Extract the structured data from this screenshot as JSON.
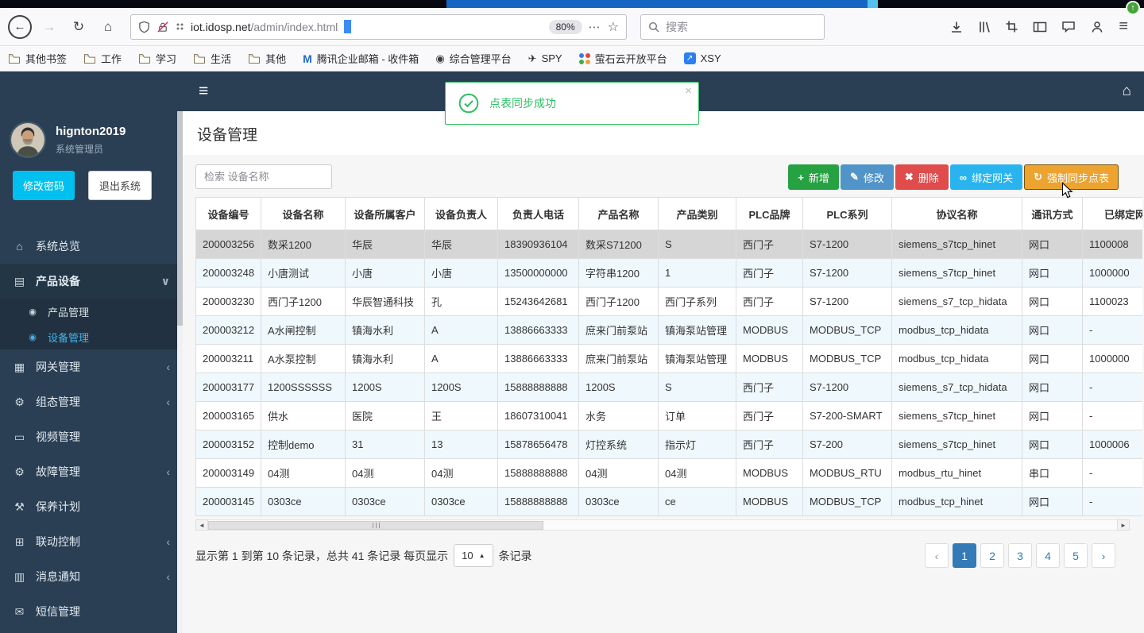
{
  "browser": {
    "nav": {
      "back": "←",
      "forward": "→",
      "reload": "↻",
      "home": "⌂"
    },
    "urlbar": {
      "domain": "iot.idosp.net",
      "path": "/admin/index.html",
      "zoom": "80%",
      "overflow": "⋯",
      "star": "☆"
    },
    "search": {
      "placeholder": "搜索"
    },
    "menu_glyph": "≡",
    "update_badge": "↑",
    "bookmarks": [
      {
        "label": "其他书签",
        "type": "folder"
      },
      {
        "label": "工作",
        "type": "folder"
      },
      {
        "label": "学习",
        "type": "folder"
      },
      {
        "label": "生活",
        "type": "folder"
      },
      {
        "label": "其他",
        "type": "folder"
      },
      {
        "label": "腾讯企业邮箱 - 收件箱",
        "type": "site",
        "icon": "mail-favicon",
        "fav": {
          "kind": "letter",
          "text": "M",
          "color": "#2468c8"
        }
      },
      {
        "label": "综合管理平台",
        "type": "site",
        "icon": "globe-favicon",
        "fav": {
          "kind": "glyph",
          "text": "◉",
          "color": "#3c3c43"
        }
      },
      {
        "label": "SPY",
        "type": "site",
        "icon": "plane-favicon",
        "fav": {
          "kind": "glyph",
          "text": "✈",
          "color": "#2f2f35"
        }
      },
      {
        "label": "萤石云开放平台",
        "type": "site",
        "icon": "dots-favicon",
        "fav": {
          "kind": "dots"
        }
      },
      {
        "label": "XSY",
        "type": "site",
        "icon": "arrow-square-favicon",
        "fav": {
          "kind": "square",
          "text": "↗",
          "color": "#2d7ff0"
        }
      }
    ]
  },
  "app": {
    "header": {
      "hamburger": "≡",
      "home": "⌂"
    },
    "toast": {
      "message": "点表同步成功",
      "close": "×"
    },
    "sidebar": {
      "username": "hignton2019",
      "role": "系统管理员",
      "change_password": "修改密码",
      "logout": "退出系统",
      "menu": [
        {
          "label": "系统总览",
          "icon": "home-icon",
          "glyph": "⌂"
        },
        {
          "label": "产品设备",
          "icon": "book-icon",
          "glyph": "▤",
          "state": "expanded",
          "chevron": "∨"
        },
        {
          "label": "产品管理",
          "icon": "dot-circle-icon",
          "glyph": "◉",
          "sub": true
        },
        {
          "label": "设备管理",
          "icon": "dot-circle-icon",
          "glyph": "◉",
          "sub": true,
          "active": true
        },
        {
          "label": "网关管理",
          "icon": "card-icon",
          "glyph": "▦",
          "chevron": "‹"
        },
        {
          "label": "组态管理",
          "icon": "gears-icon",
          "glyph": "⚙",
          "chevron": "‹"
        },
        {
          "label": "视频管理",
          "icon": "monitor-icon",
          "glyph": "▭"
        },
        {
          "label": "故障管理",
          "icon": "gears-icon",
          "glyph": "⚙",
          "chevron": "‹"
        },
        {
          "label": "保养计划",
          "icon": "wrench-icon",
          "glyph": "⚒"
        },
        {
          "label": "联动控制",
          "icon": "sitemap-icon",
          "glyph": "⊞",
          "chevron": "‹"
        },
        {
          "label": "消息通知",
          "icon": "message-icon",
          "glyph": "▥",
          "chevron": "‹"
        },
        {
          "label": "短信管理",
          "icon": "envelope-icon",
          "glyph": "✉"
        }
      ]
    },
    "page": {
      "title": "设备管理",
      "search_placeholder": "检索 设备名称",
      "buttons": [
        {
          "name": "add-button",
          "label": "新增",
          "icon": "plus-icon",
          "glyph": "+",
          "color": "#27a243"
        },
        {
          "name": "edit-button",
          "label": "修改",
          "icon": "pencil-icon",
          "glyph": "✎",
          "color": "#5094c9"
        },
        {
          "name": "delete-button",
          "label": "删除",
          "icon": "x-icon",
          "glyph": "✖",
          "color": "#e04b4b"
        },
        {
          "name": "bind-gateway-button",
          "label": "绑定网关",
          "icon": "link-icon",
          "glyph": "∞",
          "color": "#29b4ef"
        },
        {
          "name": "force-sync-button",
          "label": "强制同步点表",
          "icon": "sync-icon",
          "glyph": "↻",
          "color": "#eda32f",
          "focused": true
        }
      ],
      "table": {
        "columns": [
          "设备编号",
          "设备名称",
          "设备所属客户",
          "设备负责人",
          "负责人电话",
          "产品名称",
          "产品类别",
          "PLC品牌",
          "PLC系列",
          "协议名称",
          "通讯方式",
          "已绑定网关"
        ],
        "rows": [
          [
            "200003256",
            "数采1200",
            "华辰",
            "华辰",
            "18390936104",
            "数采S71200",
            "S",
            "西门子",
            "S7-1200",
            "siemens_s7tcp_hinet",
            "网口",
            "1100008"
          ],
          [
            "200003248",
            "小唐测试",
            "小唐",
            "小唐",
            "13500000000",
            "字符串1200",
            "1",
            "西门子",
            "S7-1200",
            "siemens_s7tcp_hinet",
            "网口",
            "1000000"
          ],
          [
            "200003230",
            "西门子1200",
            "华辰智通科技",
            "孔",
            "15243642681",
            "西门子1200",
            "西门子系列",
            "西门子",
            "S7-1200",
            "siemens_s7_tcp_hidata",
            "网口",
            "1100023"
          ],
          [
            "200003212",
            "A水闸控制",
            "镇海水利",
            "A",
            "13886663333",
            "庶来门前泵站",
            "镇海泵站管理",
            "MODBUS",
            "MODBUS_TCP",
            "modbus_tcp_hidata",
            "网口",
            "-"
          ],
          [
            "200003211",
            "A水泵控制",
            "镇海水利",
            "A",
            "13886663333",
            "庶来门前泵站",
            "镇海泵站管理",
            "MODBUS",
            "MODBUS_TCP",
            "modbus_tcp_hidata",
            "网口",
            "1000000"
          ],
          [
            "200003177",
            "1200SSSSSS",
            "1200S",
            "1200S",
            "15888888888",
            "1200S",
            "S",
            "西门子",
            "S7-1200",
            "siemens_s7_tcp_hidata",
            "网口",
            "-"
          ],
          [
            "200003165",
            "供水",
            "医院",
            "王",
            "18607310041",
            "水务",
            "订单",
            "西门子",
            "S7-200-SMART",
            "siemens_s7tcp_hinet",
            "网口",
            "-"
          ],
          [
            "200003152",
            "控制demo",
            "31",
            "13",
            "15878656478",
            "灯控系统",
            "指示灯",
            "西门子",
            "S7-200",
            "siemens_s7tcp_hinet",
            "网口",
            "1000006"
          ],
          [
            "200003149",
            "04测",
            "04测",
            "04测",
            "15888888888",
            "04测",
            "04测",
            "MODBUS",
            "MODBUS_RTU",
            "modbus_rtu_hinet",
            "串口",
            "-"
          ],
          [
            "200003145",
            "0303ce",
            "0303ce",
            "0303ce",
            "15888888888",
            "0303ce",
            "ce",
            "MODBUS",
            "MODBUS_TCP",
            "modbus_tcp_hinet",
            "网口",
            "-"
          ]
        ],
        "selected_row": 0
      },
      "scrollbar": {
        "left": "◄",
        "right": "►"
      },
      "pagination": {
        "info_prefix": "显示第 1 到第 10 条记录，总共 41 条记录 每页显示",
        "page_size": "10",
        "size_caret": "▲",
        "info_suffix": "条记录",
        "prev": "‹",
        "next": "›",
        "pages": [
          "1",
          "2",
          "3",
          "4",
          "5"
        ],
        "active_page": "1"
      }
    }
  }
}
